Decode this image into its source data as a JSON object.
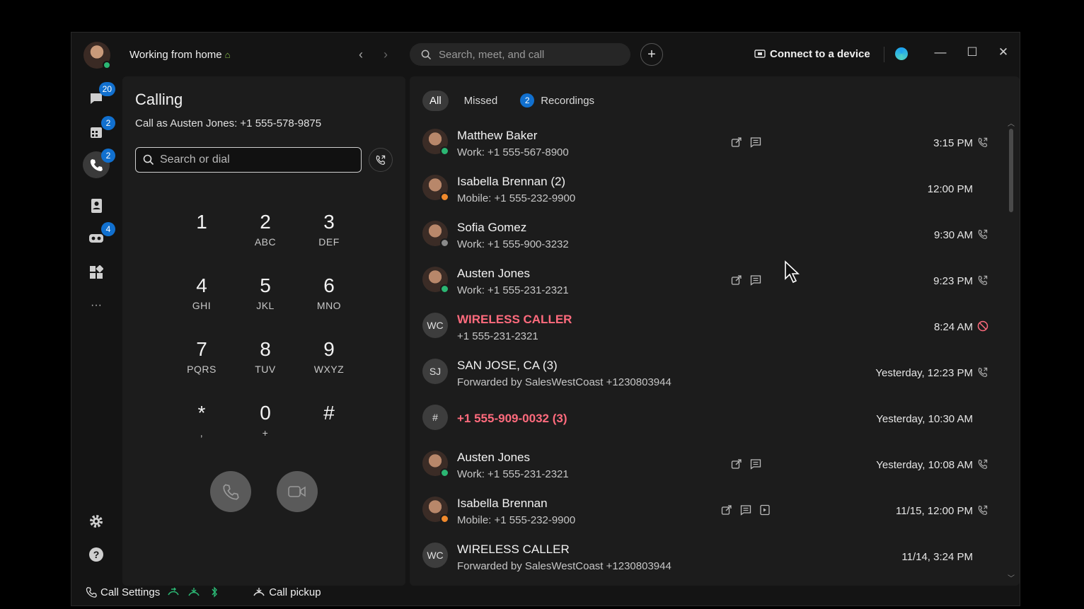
{
  "titlebar": {
    "status": "Working from home",
    "search_placeholder": "Search, meet, and call",
    "connect_label": "Connect to a device"
  },
  "rail": {
    "badges": {
      "messaging": "20",
      "meetings": "2",
      "calling": "2",
      "voicemail": "4"
    },
    "more": "···"
  },
  "dialpad": {
    "title": "Calling",
    "call_as": "Call as Austen Jones: +1 555-578-9875",
    "search_placeholder": "Search or dial",
    "keys": [
      {
        "num": "1",
        "letters": ""
      },
      {
        "num": "2",
        "letters": "ABC"
      },
      {
        "num": "3",
        "letters": "DEF"
      },
      {
        "num": "4",
        "letters": "GHI"
      },
      {
        "num": "5",
        "letters": "JKL"
      },
      {
        "num": "6",
        "letters": "MNO"
      },
      {
        "num": "7",
        "letters": "PQRS"
      },
      {
        "num": "8",
        "letters": "TUV"
      },
      {
        "num": "9",
        "letters": "WXYZ"
      },
      {
        "num": "*",
        "letters": ","
      },
      {
        "num": "0",
        "letters": "+"
      },
      {
        "num": "#",
        "letters": ""
      }
    ]
  },
  "bottom": {
    "call_settings": "Call Settings",
    "call_pickup": "Call pickup"
  },
  "tabs": {
    "all": "All",
    "missed": "Missed",
    "recordings_count": "2",
    "recordings": "Recordings"
  },
  "colors": {
    "accent": "#1170cf",
    "missed": "#ff6b7d",
    "presence_active": "#2bb673",
    "presence_away": "#f0892c"
  },
  "calls": [
    {
      "initials": "",
      "photo": true,
      "presence": "active",
      "name": "Matthew Baker",
      "detail": "Work: +1 555-567-8900",
      "time": "3:15 PM",
      "missed": false,
      "actions": [
        "share-icon",
        "message-icon"
      ],
      "end": "outgoing-call-icon"
    },
    {
      "initials": "",
      "photo": true,
      "presence": "away",
      "name": "Isabella Brennan (2)",
      "detail": "Mobile: +1 555-232-9900",
      "time": "12:00 PM",
      "missed": false,
      "actions": [],
      "end": ""
    },
    {
      "initials": "",
      "photo": true,
      "presence": "clock",
      "name": "Sofia Gomez",
      "detail": "Work: +1 555-900-3232",
      "time": "9:30 AM",
      "missed": false,
      "actions": [],
      "end": "outgoing-call-icon"
    },
    {
      "initials": "",
      "photo": true,
      "presence": "active",
      "name": "Austen Jones",
      "detail": "Work: +1 555-231-2321",
      "time": "9:23 PM",
      "missed": false,
      "actions": [
        "share-icon",
        "message-icon"
      ],
      "end": "outgoing-call-icon"
    },
    {
      "initials": "WC",
      "photo": false,
      "presence": "",
      "name": "WIRELESS CALLER",
      "detail": "+1 555-231-2321",
      "time": "8:24 AM",
      "missed": true,
      "actions": [],
      "end": "blocked-icon"
    },
    {
      "initials": "SJ",
      "photo": false,
      "presence": "",
      "name": "SAN JOSE, CA (3)",
      "detail": "Forwarded by SalesWestCoast +1230803944",
      "time": "Yesterday, 12:23 PM",
      "missed": false,
      "actions": [],
      "end": "outgoing-call-icon"
    },
    {
      "initials": "#",
      "photo": false,
      "presence": "",
      "name": "+1 555-909-0032 (3)",
      "detail": "",
      "time": "Yesterday, 10:30 AM",
      "missed": true,
      "actions": [],
      "end": ""
    },
    {
      "initials": "",
      "photo": true,
      "presence": "active",
      "name": "Austen Jones",
      "detail": "Work: +1 555-231-2321",
      "time": "Yesterday, 10:08 AM",
      "missed": false,
      "actions": [
        "share-icon",
        "message-icon"
      ],
      "end": "outgoing-call-icon"
    },
    {
      "initials": "",
      "photo": true,
      "presence": "away",
      "name": "Isabella Brennan",
      "detail": "Mobile: +1 555-232-9900",
      "time": "11/15, 12:00 PM",
      "missed": false,
      "actions": [
        "share-icon",
        "message-icon",
        "voicemail-file-icon"
      ],
      "end": "outgoing-call-icon"
    },
    {
      "initials": "WC",
      "photo": false,
      "presence": "",
      "name": "WIRELESS CALLER",
      "detail": "Forwarded by SalesWestCoast +1230803944",
      "time": "11/14, 3:24 PM",
      "missed": false,
      "actions": [],
      "end": ""
    }
  ]
}
